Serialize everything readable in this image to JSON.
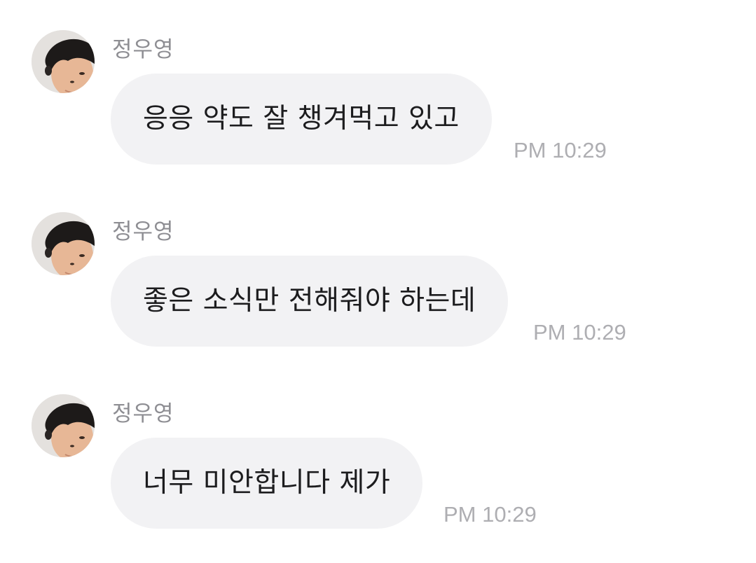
{
  "messages": [
    {
      "sender": "정우영",
      "avatar_icon": "profile-photo",
      "text": "응응 약도 잘 챙겨먹고 있고",
      "time": "PM 10:29"
    },
    {
      "sender": "정우영",
      "avatar_icon": "profile-photo",
      "text": "좋은 소식만 전해줘야 하는데",
      "time": "PM 10:29"
    },
    {
      "sender": "정우영",
      "avatar_icon": "profile-photo",
      "text": "너무 미안합니다 제가",
      "time": "PM 10:29"
    }
  ],
  "colors": {
    "bubble": "#f2f2f4",
    "text": "#1c1c1e",
    "sender": "#8e8e93",
    "timestamp": "#aeaeb2",
    "background": "#ffffff"
  }
}
